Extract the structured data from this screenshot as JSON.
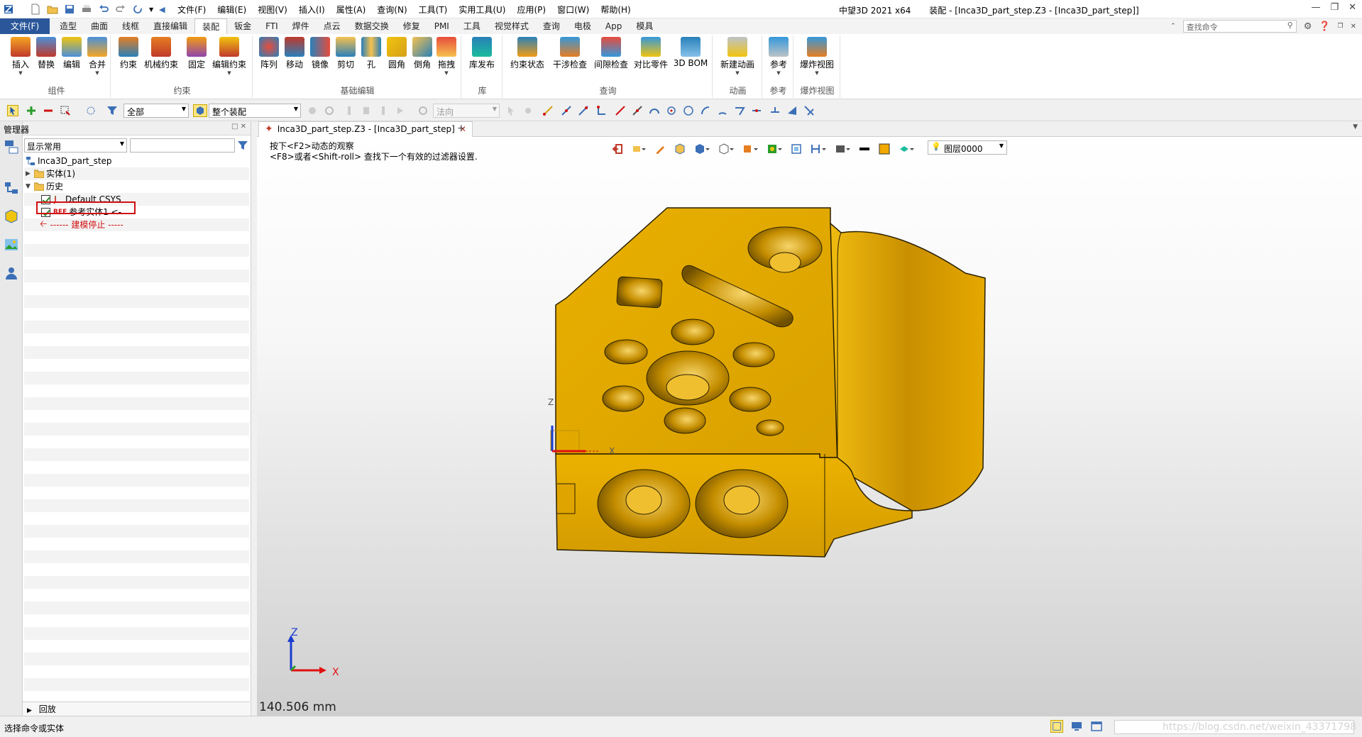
{
  "titlebar": {
    "menus": [
      "文件(F)",
      "编辑(E)",
      "视图(V)",
      "插入(I)",
      "属性(A)",
      "查询(N)",
      "工具(T)",
      "实用工具(U)",
      "应用(P)",
      "窗口(W)",
      "帮助(H)"
    ],
    "app_name": "中望3D 2021 x64",
    "doc_title": "装配 - [Inca3D_part_step.Z3 - [Inca3D_part_step]]"
  },
  "ribbon_tabs": {
    "file": "文件(F)",
    "tabs": [
      "造型",
      "曲面",
      "线框",
      "直接编辑",
      "装配",
      "钣金",
      "FTI",
      "焊件",
      "点云",
      "数据交换",
      "修复",
      "PMI",
      "工具",
      "视觉样式",
      "查询",
      "电极",
      "App",
      "模具"
    ],
    "active": "装配",
    "search_placeholder": "查找命令"
  },
  "ribbon_groups": [
    {
      "name": "组件",
      "buttons": [
        "插入",
        "替换",
        "编辑",
        "合并"
      ]
    },
    {
      "name": "约束",
      "buttons": [
        "约束",
        "机械约束",
        "固定",
        "编辑约束"
      ]
    },
    {
      "name": "基础编辑",
      "buttons": [
        "阵列",
        "移动",
        "镜像",
        "剪切",
        "孔",
        "圆角",
        "倒角",
        "拖拽"
      ]
    },
    {
      "name": "库",
      "buttons": [
        "库发布"
      ]
    },
    {
      "name": "查询",
      "buttons": [
        "约束状态",
        "干涉检查",
        "间隙检查",
        "对比零件",
        "3D BOM"
      ]
    },
    {
      "name": "动画",
      "buttons": [
        "新建动画"
      ]
    },
    {
      "name": "参考",
      "buttons": [
        "参考"
      ]
    },
    {
      "name": "爆炸视图",
      "buttons": [
        "爆炸视图"
      ]
    }
  ],
  "filter_bar": {
    "filter_value": "全部",
    "scope_value": "整个装配",
    "normal_value": "法向"
  },
  "manager": {
    "title": "管理器",
    "view_mode": "显示常用",
    "tree": {
      "root": "Inca3D_part_step",
      "solids": "实体(1)",
      "history": "历史",
      "csys": "Default CSYS",
      "ref_solid": "参考实体1 <-",
      "stop": "------ 建模停止 -----"
    },
    "rollback": "回放"
  },
  "doc_tab": {
    "label": "Inca3D_part_step.Z3 - [Inca3D_part_step]"
  },
  "viewport": {
    "hint_line1": "按下<F2>动态的观察",
    "hint_line2": "<F8>或者<Shift-roll> 查找下一个有效的过滤器设置.",
    "layer": "图层0000",
    "measure": "140.506 mm",
    "axis_x": "X",
    "axis_z": "Z",
    "part_color": "#e8a800"
  },
  "statusbar": {
    "text": "选择命令或实体",
    "watermark": "https://blog.csdn.net/weixin_43371798"
  }
}
